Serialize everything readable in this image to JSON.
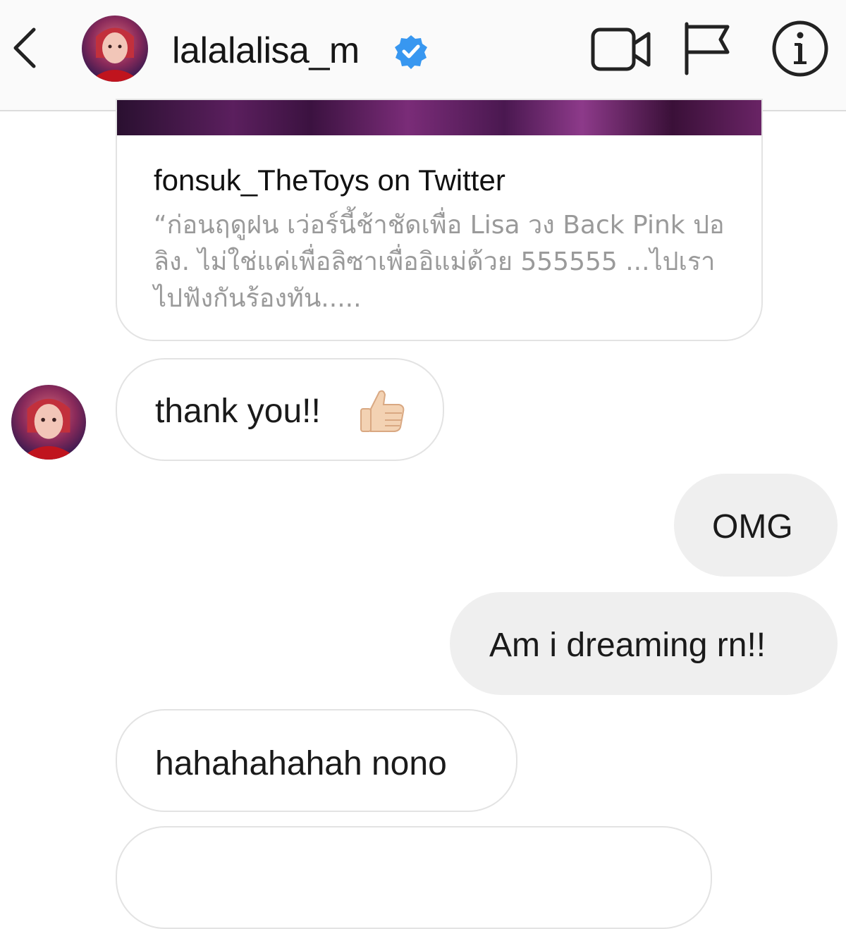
{
  "header": {
    "username": "lalalalisa_m",
    "verified": true,
    "icons": [
      "back-arrow-icon",
      "video-call-icon",
      "flag-icon",
      "info-icon"
    ]
  },
  "link_card": {
    "title": "fonsuk_TheToys on Twitter",
    "description": "“ก่อนฤดูฝน เว่อร์นี้ช้าชัดเพื่อ Lisa วง Back Pink ปอลิง. ไม่ใช่แค่เพื่อลิซาเพื่ออิแม่ด้วย 555555 ...ไปเราไปฟังกันร้องทัน....."
  },
  "messages": [
    {
      "from": "them",
      "text": "thank you!!",
      "emoji": "👍🏻"
    },
    {
      "from": "me",
      "text": "OMG"
    },
    {
      "from": "me",
      "text": "Am i dreaming rn!!"
    },
    {
      "from": "them",
      "text": "hahahahahah nono"
    }
  ],
  "colors": {
    "verified": "#3897f0",
    "outgoing_bubble": "#efefef",
    "incoming_border": "#e3e3e3",
    "header_bg": "#fafafa"
  }
}
